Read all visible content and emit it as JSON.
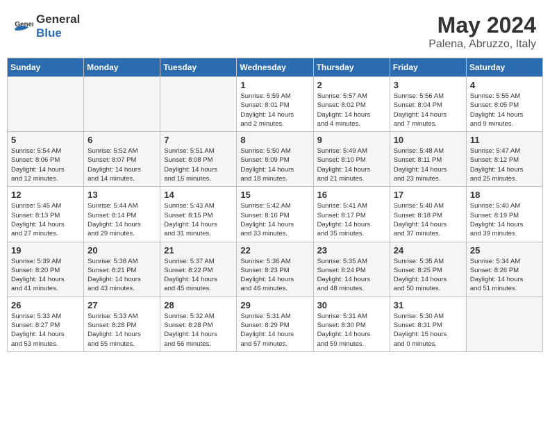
{
  "header": {
    "logo_general": "General",
    "logo_blue": "Blue",
    "month_year": "May 2024",
    "location": "Palena, Abruzzo, Italy"
  },
  "days_of_week": [
    "Sunday",
    "Monday",
    "Tuesday",
    "Wednesday",
    "Thursday",
    "Friday",
    "Saturday"
  ],
  "weeks": [
    [
      {
        "day": "",
        "info": ""
      },
      {
        "day": "",
        "info": ""
      },
      {
        "day": "",
        "info": ""
      },
      {
        "day": "1",
        "info": "Sunrise: 5:59 AM\nSunset: 8:01 PM\nDaylight: 14 hours\nand 2 minutes."
      },
      {
        "day": "2",
        "info": "Sunrise: 5:57 AM\nSunset: 8:02 PM\nDaylight: 14 hours\nand 4 minutes."
      },
      {
        "day": "3",
        "info": "Sunrise: 5:56 AM\nSunset: 8:04 PM\nDaylight: 14 hours\nand 7 minutes."
      },
      {
        "day": "4",
        "info": "Sunrise: 5:55 AM\nSunset: 8:05 PM\nDaylight: 14 hours\nand 9 minutes."
      }
    ],
    [
      {
        "day": "5",
        "info": "Sunrise: 5:54 AM\nSunset: 8:06 PM\nDaylight: 14 hours\nand 12 minutes."
      },
      {
        "day": "6",
        "info": "Sunrise: 5:52 AM\nSunset: 8:07 PM\nDaylight: 14 hours\nand 14 minutes."
      },
      {
        "day": "7",
        "info": "Sunrise: 5:51 AM\nSunset: 8:08 PM\nDaylight: 14 hours\nand 16 minutes."
      },
      {
        "day": "8",
        "info": "Sunrise: 5:50 AM\nSunset: 8:09 PM\nDaylight: 14 hours\nand 18 minutes."
      },
      {
        "day": "9",
        "info": "Sunrise: 5:49 AM\nSunset: 8:10 PM\nDaylight: 14 hours\nand 21 minutes."
      },
      {
        "day": "10",
        "info": "Sunrise: 5:48 AM\nSunset: 8:11 PM\nDaylight: 14 hours\nand 23 minutes."
      },
      {
        "day": "11",
        "info": "Sunrise: 5:47 AM\nSunset: 8:12 PM\nDaylight: 14 hours\nand 25 minutes."
      }
    ],
    [
      {
        "day": "12",
        "info": "Sunrise: 5:45 AM\nSunset: 8:13 PM\nDaylight: 14 hours\nand 27 minutes."
      },
      {
        "day": "13",
        "info": "Sunrise: 5:44 AM\nSunset: 8:14 PM\nDaylight: 14 hours\nand 29 minutes."
      },
      {
        "day": "14",
        "info": "Sunrise: 5:43 AM\nSunset: 8:15 PM\nDaylight: 14 hours\nand 31 minutes."
      },
      {
        "day": "15",
        "info": "Sunrise: 5:42 AM\nSunset: 8:16 PM\nDaylight: 14 hours\nand 33 minutes."
      },
      {
        "day": "16",
        "info": "Sunrise: 5:41 AM\nSunset: 8:17 PM\nDaylight: 14 hours\nand 35 minutes."
      },
      {
        "day": "17",
        "info": "Sunrise: 5:40 AM\nSunset: 8:18 PM\nDaylight: 14 hours\nand 37 minutes."
      },
      {
        "day": "18",
        "info": "Sunrise: 5:40 AM\nSunset: 8:19 PM\nDaylight: 14 hours\nand 39 minutes."
      }
    ],
    [
      {
        "day": "19",
        "info": "Sunrise: 5:39 AM\nSunset: 8:20 PM\nDaylight: 14 hours\nand 41 minutes."
      },
      {
        "day": "20",
        "info": "Sunrise: 5:38 AM\nSunset: 8:21 PM\nDaylight: 14 hours\nand 43 minutes."
      },
      {
        "day": "21",
        "info": "Sunrise: 5:37 AM\nSunset: 8:22 PM\nDaylight: 14 hours\nand 45 minutes."
      },
      {
        "day": "22",
        "info": "Sunrise: 5:36 AM\nSunset: 8:23 PM\nDaylight: 14 hours\nand 46 minutes."
      },
      {
        "day": "23",
        "info": "Sunrise: 5:35 AM\nSunset: 8:24 PM\nDaylight: 14 hours\nand 48 minutes."
      },
      {
        "day": "24",
        "info": "Sunrise: 5:35 AM\nSunset: 8:25 PM\nDaylight: 14 hours\nand 50 minutes."
      },
      {
        "day": "25",
        "info": "Sunrise: 5:34 AM\nSunset: 8:26 PM\nDaylight: 14 hours\nand 51 minutes."
      }
    ],
    [
      {
        "day": "26",
        "info": "Sunrise: 5:33 AM\nSunset: 8:27 PM\nDaylight: 14 hours\nand 53 minutes."
      },
      {
        "day": "27",
        "info": "Sunrise: 5:33 AM\nSunset: 8:28 PM\nDaylight: 14 hours\nand 55 minutes."
      },
      {
        "day": "28",
        "info": "Sunrise: 5:32 AM\nSunset: 8:28 PM\nDaylight: 14 hours\nand 56 minutes."
      },
      {
        "day": "29",
        "info": "Sunrise: 5:31 AM\nSunset: 8:29 PM\nDaylight: 14 hours\nand 57 minutes."
      },
      {
        "day": "30",
        "info": "Sunrise: 5:31 AM\nSunset: 8:30 PM\nDaylight: 14 hours\nand 59 minutes."
      },
      {
        "day": "31",
        "info": "Sunrise: 5:30 AM\nSunset: 8:31 PM\nDaylight: 15 hours\nand 0 minutes."
      },
      {
        "day": "",
        "info": ""
      }
    ]
  ]
}
